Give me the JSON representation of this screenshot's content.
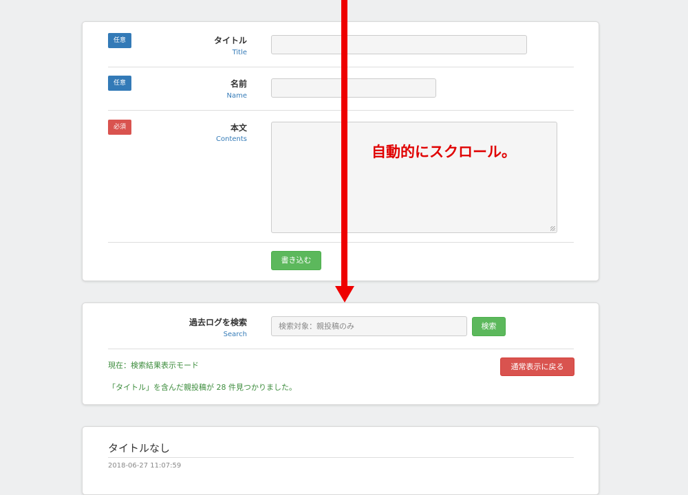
{
  "form": {
    "title_field": {
      "badge": "任意",
      "label": "タイトル",
      "sublabel": "Title",
      "value": ""
    },
    "name_field": {
      "badge": "任意",
      "label": "名前",
      "sublabel": "Name",
      "value": ""
    },
    "contents_field": {
      "badge": "必須",
      "label": "本文",
      "sublabel": "Contents",
      "value": ""
    },
    "submit_label": "書き込む"
  },
  "search": {
    "label": "過去ログを検索",
    "sublabel": "Search",
    "placeholder": "検索対象：親投稿のみ",
    "button_label": "検索",
    "mode_text": "現在：検索結果表示モード",
    "result_text": "「タイトル」を含んだ親投稿が 28 件見つかりました。",
    "back_button_label": "通常表示に戻る"
  },
  "post": {
    "title": "タイトルなし",
    "date": "2018-06-27 11:07:59"
  },
  "annotation": {
    "text": "自動的にスクロール。",
    "color": "#ee0000"
  },
  "colors": {
    "badge_optional": "#337ab7",
    "badge_required": "#d9534f",
    "success": "#5cb85c",
    "danger": "#d9534f"
  }
}
